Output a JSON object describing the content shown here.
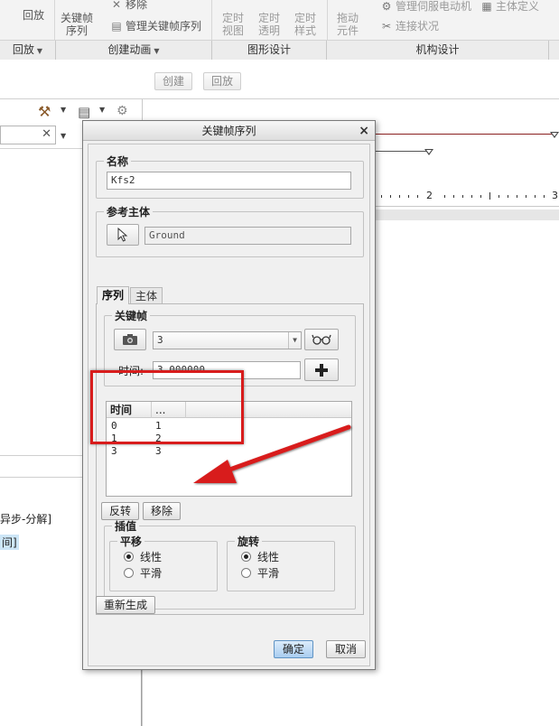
{
  "ribbon": {
    "buttons": {
      "playback": "回放",
      "keyframe_seq": [
        "关键帧",
        "序列"
      ],
      "timed_view": [
        "定时",
        "视图"
      ],
      "timed_transparency": [
        "定时",
        "透明"
      ],
      "timed_style": [
        "定时",
        "样式"
      ],
      "drag_component": [
        "拖动",
        "元件"
      ]
    },
    "small": {
      "move": "移除",
      "manage_keyframe_seq": "管理关键帧序列",
      "manage_servo": "管理伺服电动机",
      "connection_status": "连接状况",
      "body_define": "主体定义"
    },
    "groups": [
      "回放",
      "创建动画",
      "图形设计",
      "机构设计"
    ]
  },
  "timeline": {
    "create_btn": "创建",
    "playback_btn": "回放",
    "ruler_labels": [
      "2",
      "3"
    ]
  },
  "left_panel": {
    "text1": "异步-分解]",
    "text2": "间]"
  },
  "dialog": {
    "title": "关键帧序列",
    "close": "×",
    "name_group": "名称",
    "name_value": "Kfs2",
    "ref_body_group": "参考主体",
    "ref_body_value": "Ground",
    "tabs": [
      "序列",
      "主体"
    ],
    "keyframe_group": "关键帧",
    "keyframe_selected": "3",
    "time_label": "时间:",
    "time_value": "3.000000",
    "table": {
      "columns": [
        "时间",
        "..."
      ],
      "rows": [
        [
          "0",
          "1"
        ],
        [
          "1",
          "2"
        ],
        [
          "3",
          "3"
        ]
      ]
    },
    "reverse_btn": "反转",
    "remove_btn": "移除",
    "interp_group": "插值",
    "translation_group": "平移",
    "rotation_group": "旋转",
    "translation_options": [
      {
        "label": "线性",
        "selected": true
      },
      {
        "label": "平滑",
        "selected": false
      }
    ],
    "rotation_options": [
      {
        "label": "线性",
        "selected": true
      },
      {
        "label": "平滑",
        "selected": false
      }
    ],
    "regenerate_btn": "重新生成",
    "ok_btn": "确定",
    "cancel_btn": "取消"
  },
  "colors": {
    "highlight": "#d81c1c",
    "primary_button": "#a9cdf0"
  }
}
